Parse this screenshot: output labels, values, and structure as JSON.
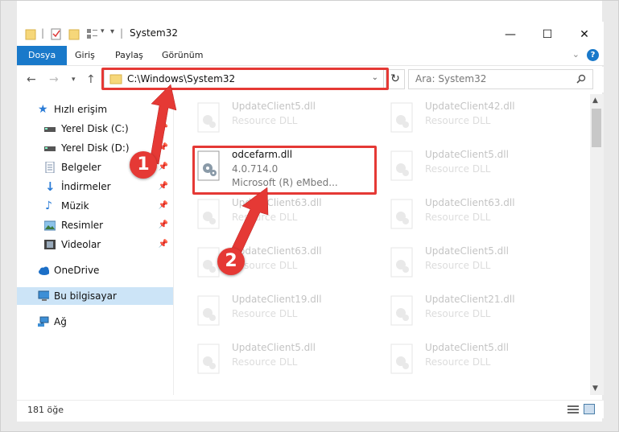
{
  "titlebar": {
    "title": "System32"
  },
  "ribbon": {
    "tabs": [
      "Dosya",
      "Giriş",
      "Paylaş",
      "Görünüm"
    ]
  },
  "address": {
    "path": "C:\\Windows\\System32",
    "search_placeholder": "Ara: System32"
  },
  "nav": {
    "items": [
      {
        "label": "Hızlı erişim",
        "icon": "star-icon"
      },
      {
        "label": "Yerel Disk (C:)",
        "icon": "drive-icon",
        "pinned": true
      },
      {
        "label": "Yerel Disk (D:)",
        "icon": "drive-icon",
        "pinned": true
      },
      {
        "label": "Belgeler",
        "icon": "document-icon",
        "pinned": true
      },
      {
        "label": "İndirmeler",
        "icon": "download-icon",
        "pinned": true
      },
      {
        "label": "Müzik",
        "icon": "music-icon",
        "pinned": true
      },
      {
        "label": "Resimler",
        "icon": "pictures-icon",
        "pinned": true
      },
      {
        "label": "Videolar",
        "icon": "video-icon",
        "pinned": true
      },
      {
        "label": "OneDrive",
        "icon": "cloud-icon"
      },
      {
        "label": "Bu bilgisayar",
        "icon": "computer-icon",
        "selected": true
      },
      {
        "label": "Ağ",
        "icon": "network-icon"
      }
    ]
  },
  "files": {
    "col1": [
      {
        "name": "UpdateClient5.dll",
        "type": "Resource DLL"
      },
      {
        "name": "odcefarm.dll",
        "version": "4.0.714.0",
        "desc": "Microsoft (R) eMbed..."
      },
      {
        "name": "UpdateClient63.dll",
        "type": "Resource DLL"
      },
      {
        "name": "UpdateClient63.dll",
        "type": "Resource DLL"
      },
      {
        "name": "UpdateClient19.dll",
        "type": "Resource DLL"
      },
      {
        "name": "UpdateClient5.dll",
        "type": "Resource DLL"
      }
    ],
    "col2": [
      {
        "name": "UpdateClient42.dll",
        "type": "Resource DLL"
      },
      {
        "name": "UpdateClient5.dll",
        "type": "Resource DLL"
      },
      {
        "name": "UpdateClient63.dll",
        "type": "Resource DLL"
      },
      {
        "name": "UpdateClient5.dll",
        "type": "Resource DLL"
      },
      {
        "name": "UpdateClient21.dll",
        "type": "Resource DLL"
      },
      {
        "name": "UpdateClient5.dll",
        "type": "Resource DLL"
      }
    ]
  },
  "status": {
    "count": "181 öğe"
  },
  "callouts": {
    "one": "1",
    "two": "2"
  },
  "colors": {
    "accent": "#1979ca",
    "highlight": "#e53935"
  }
}
